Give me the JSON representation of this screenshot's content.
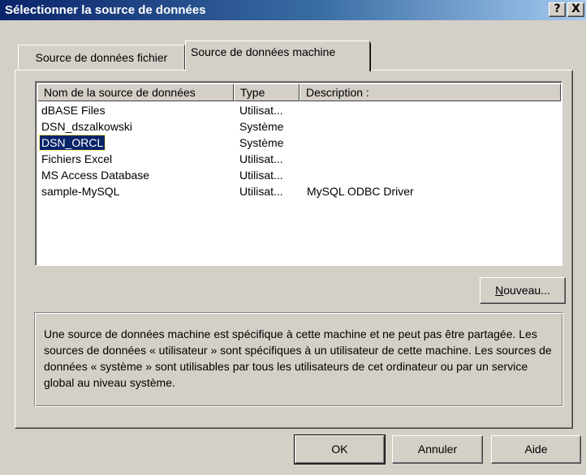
{
  "window": {
    "title": "Sélectionner la source de données",
    "help_glyph": "?",
    "close_glyph": "X"
  },
  "tabs": [
    {
      "label": "Source de données fichier"
    },
    {
      "label": "Source de données machine"
    }
  ],
  "list": {
    "columns": [
      "Nom de la source de données",
      "Type",
      "Description :"
    ],
    "rows": [
      {
        "name": "dBASE Files",
        "type": "Utilisat...",
        "description": ""
      },
      {
        "name": "DSN_dszalkowski",
        "type": "Système",
        "description": ""
      },
      {
        "name": "DSN_ORCL",
        "type": "Système",
        "description": "",
        "selected": true
      },
      {
        "name": "Fichiers Excel",
        "type": "Utilisat...",
        "description": ""
      },
      {
        "name": "MS Access Database",
        "type": "Utilisat...",
        "description": ""
      },
      {
        "name": "sample-MySQL",
        "type": "Utilisat...",
        "description": "MySQL ODBC Driver"
      }
    ]
  },
  "new_button": {
    "accel": "N",
    "rest": "ouveau..."
  },
  "description_text": "Une source de données machine est spécifique à cette machine et ne peut pas être partagée. Les sources de données « utilisateur » sont spécifiques à un utilisateur de cette machine. Les sources de données « système » sont utilisables par tous les utilisateurs de cet ordinateur ou par un service global au niveau système.",
  "buttons": {
    "ok": "OK",
    "cancel": "Annuler",
    "help": "Aide"
  },
  "colors": {
    "face": "#d4d0c8",
    "titlebar_start": "#0a246a",
    "selection": "#0a246a"
  }
}
